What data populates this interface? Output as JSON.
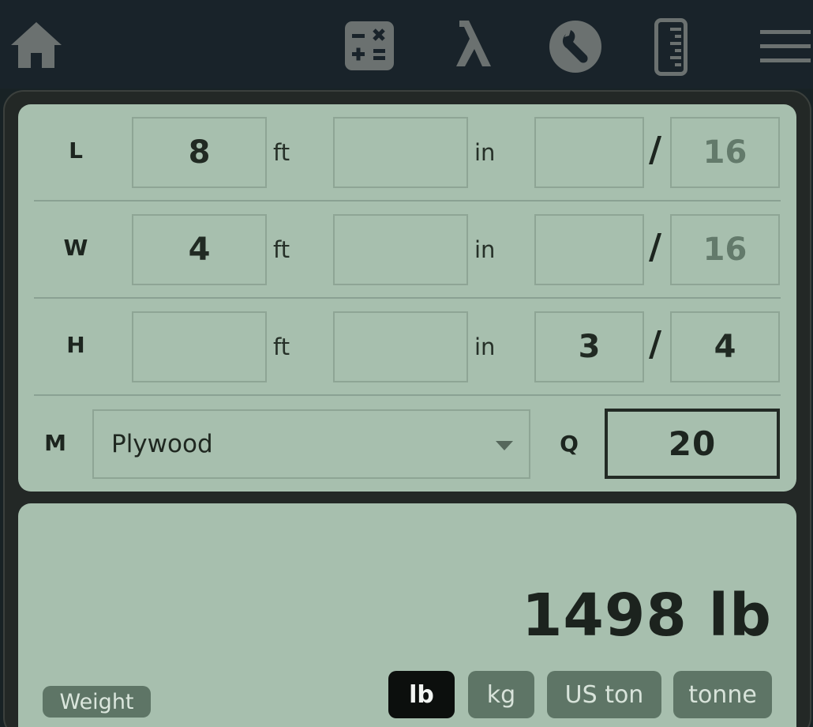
{
  "topbar": {
    "icons": [
      "home-icon",
      "calculator-icon",
      "lambda-icon",
      "wrench-icon",
      "ruler-icon",
      "menu-icon"
    ],
    "icon_color": "#6b7170"
  },
  "dimensions": {
    "length": {
      "label": "L",
      "ft": "8",
      "in": "",
      "num": "",
      "den": "16",
      "den_placeholder": true
    },
    "width": {
      "label": "W",
      "ft": "4",
      "in": "",
      "num": "",
      "den": "16",
      "den_placeholder": true
    },
    "height": {
      "label": "H",
      "ft": "",
      "in": "",
      "num": "3",
      "den": "4",
      "den_placeholder": false
    },
    "unit_ft": "ft",
    "unit_in": "in",
    "fraction_sep": "/"
  },
  "material": {
    "label": "M",
    "selected": "Plywood"
  },
  "quantity": {
    "label": "Q",
    "value": "20"
  },
  "result": {
    "value": "1498 lb",
    "kind_label": "Weight",
    "units": [
      "lb",
      "kg",
      "US ton",
      "tonne"
    ],
    "selected_unit": "lb"
  },
  "colors": {
    "panel": "#a7bfae",
    "background": "#182225",
    "chip": "#5e7566",
    "active_chip": "#0c0f0d"
  }
}
